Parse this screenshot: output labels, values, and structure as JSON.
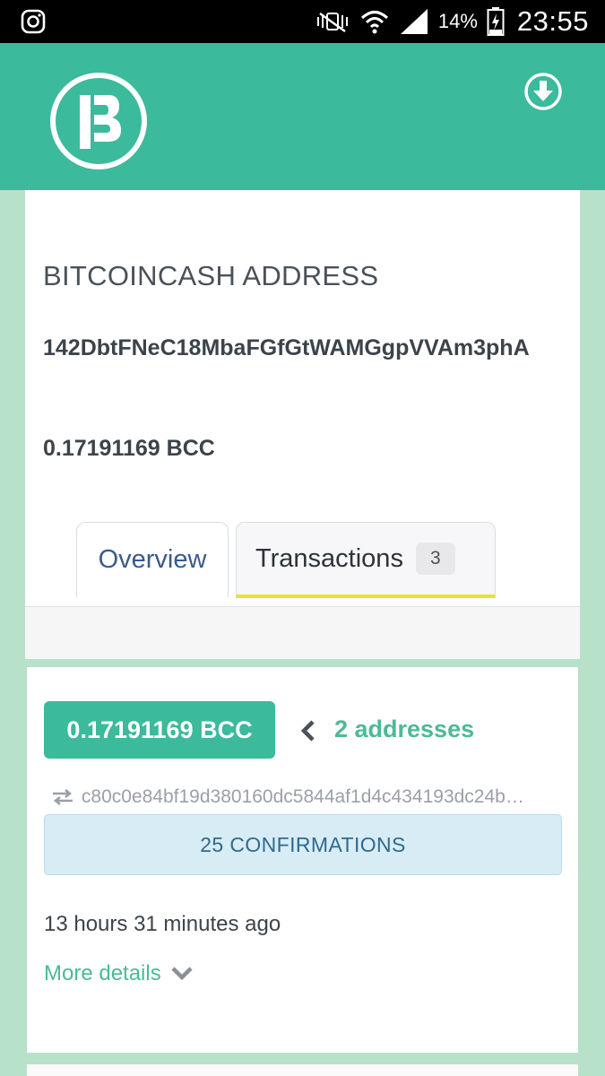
{
  "status_bar": {
    "battery_percent": "14%",
    "time": "23:55",
    "icons": [
      "instagram-icon",
      "mute-icon",
      "wifi-icon",
      "signal-icon",
      "battery-icon"
    ]
  },
  "header": {
    "logo_icon": "bitcoincash-b-logo",
    "download_icon": "download-circle-icon",
    "background_color": "#3bba9c"
  },
  "address": {
    "title": "BITCOINCASH ADDRESS",
    "hash": "142DbtFNeC18MbaFGfGtWAMGgpVVAm3phA",
    "balance": "0.17191169 BCC"
  },
  "tabs": [
    {
      "label": "Overview",
      "active": false
    },
    {
      "label": "Transactions",
      "count": "3",
      "active": true
    }
  ],
  "transaction": {
    "amount": "0.17191169 BCC",
    "addresses_label": "2 addresses",
    "tx_hash": "c80c0e84bf19d380160dc5844af1d4c434193dc24b…",
    "confirmations": "25 CONFIRMATIONS",
    "time_ago": "13 hours 31 minutes ago",
    "more_details": "More details"
  }
}
